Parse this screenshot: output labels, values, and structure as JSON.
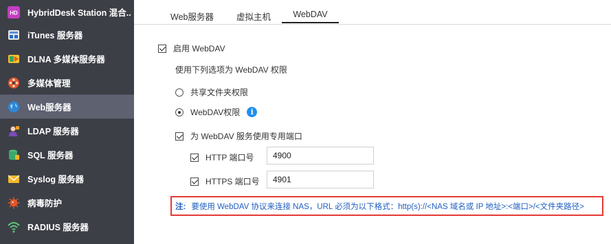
{
  "sidebar": {
    "items": [
      {
        "label": "HybridDesk Station 混合...",
        "icon": "hd-station-icon"
      },
      {
        "label": "iTunes 服务器",
        "icon": "itunes-icon"
      },
      {
        "label": "DLNA 多媒体服务器",
        "icon": "dlna-icon"
      },
      {
        "label": "多媒体管理",
        "icon": "multimedia-icon"
      },
      {
        "label": "Web服务器",
        "icon": "web-globe-icon"
      },
      {
        "label": "LDAP 服务器",
        "icon": "ldap-user-icon"
      },
      {
        "label": "SQL 服务器",
        "icon": "sql-database-icon"
      },
      {
        "label": "Syslog 服务器",
        "icon": "syslog-envelope-icon"
      },
      {
        "label": "病毒防护",
        "icon": "antivirus-icon"
      },
      {
        "label": "RADIUS 服务器",
        "icon": "radius-wifi-icon"
      }
    ],
    "active_index": 4
  },
  "tabs": [
    {
      "label": "Web服务器"
    },
    {
      "label": "虚拟主机"
    },
    {
      "label": "WebDAV"
    }
  ],
  "active_tab": "WebDAV",
  "webdav": {
    "enable_label": "启用 WebDAV",
    "enable_checked": true,
    "permission_desc": "使用下列选项为 WebDAV 权限",
    "option_shared": "共享文件夹权限",
    "option_webdav": "WebDAV权限",
    "selected_option": "WebDAV权限",
    "info_glyph": "i",
    "dedicated_port_label": "为 WebDAV 服务使用专用端口",
    "dedicated_port_checked": true,
    "http_label": "HTTP 端口号",
    "http_value": "4900",
    "https_label": "HTTPS 端口号",
    "https_value": "4901",
    "note_prefix": "注:",
    "note_text": "要使用 WebDAV 协议来连接 NAS，URL 必须为以下格式：http(s)://<NAS 域名或 IP 地址>:<端口>/<文件夹路径>"
  },
  "colors": {
    "sidebar_bg": "#3d3f47",
    "sidebar_active": "#5d6170",
    "note_border": "#e53935",
    "note_text": "#1f5fbf",
    "info_blue": "#1f8ff0"
  }
}
